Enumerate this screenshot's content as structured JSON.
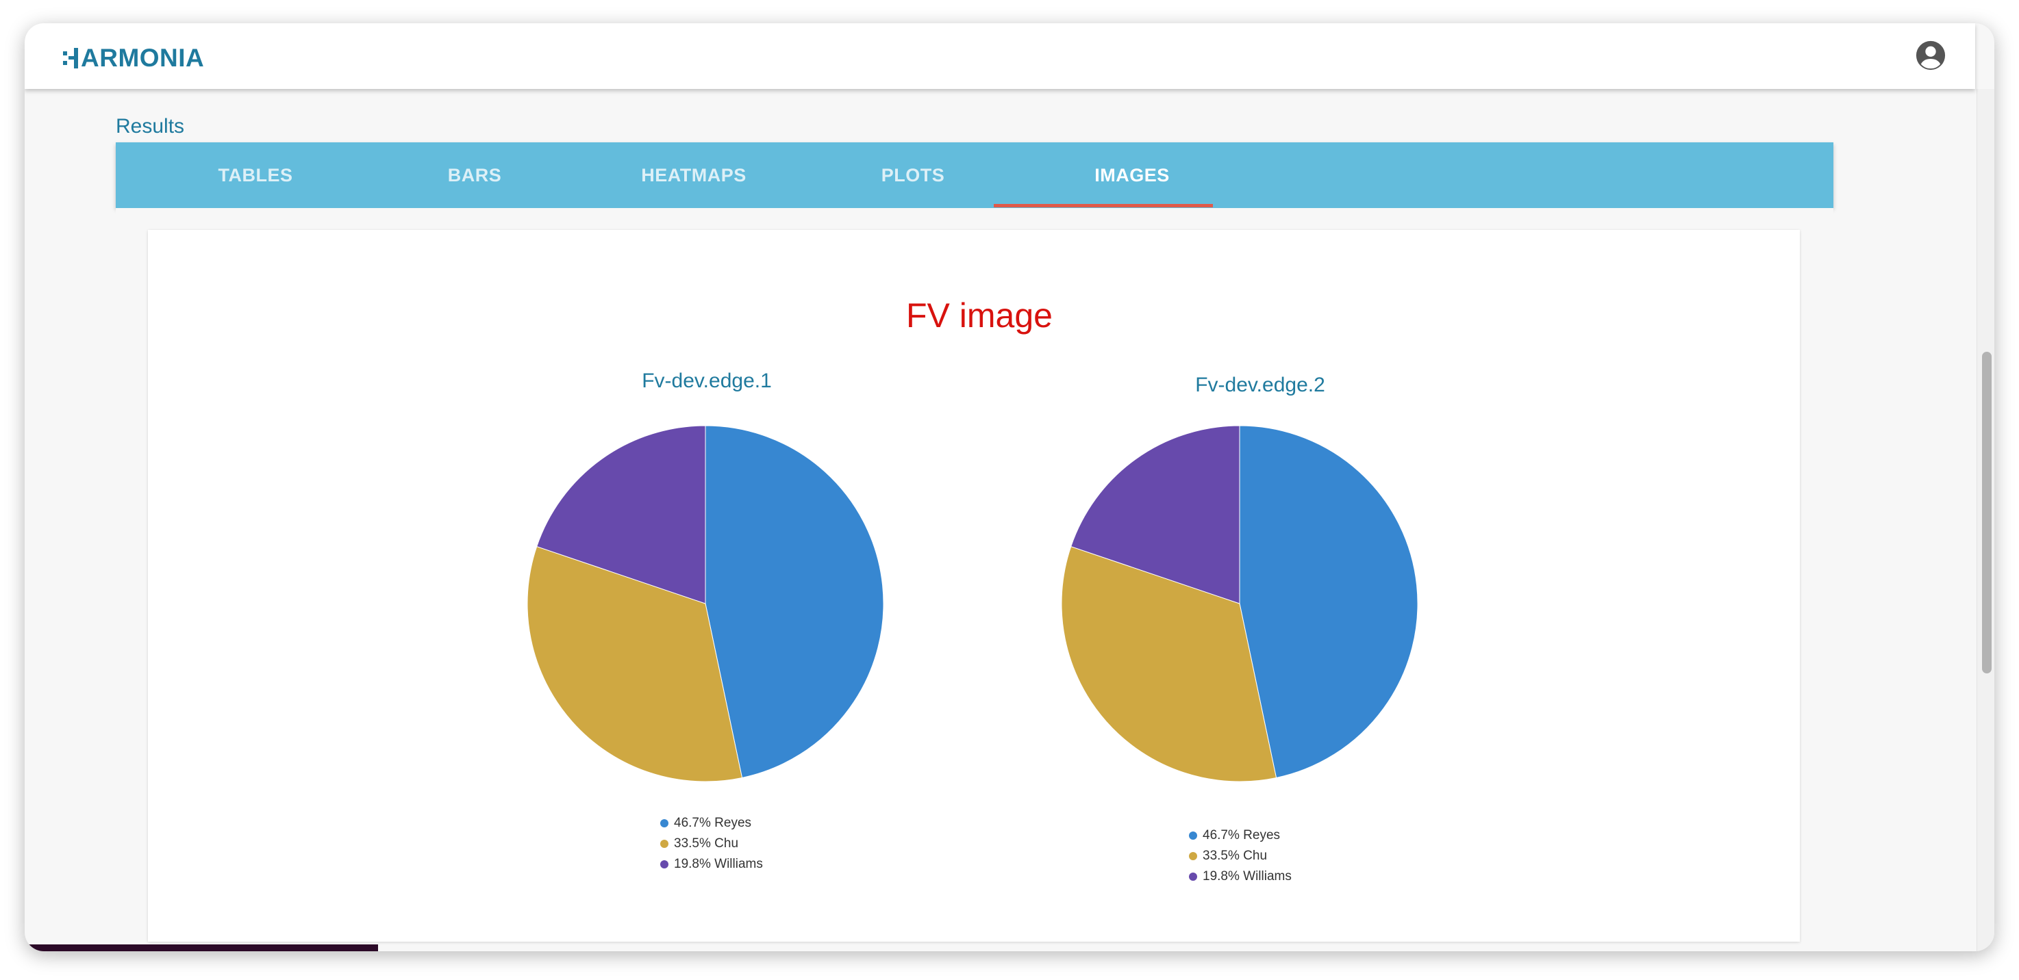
{
  "app": {
    "name": "ARMONIA"
  },
  "header": {
    "account_icon": "account-circle-icon"
  },
  "page": {
    "section_label": "Results"
  },
  "tabs": [
    {
      "label": "TABLES",
      "active": false
    },
    {
      "label": "BARS",
      "active": false
    },
    {
      "label": "HEATMAPS",
      "active": false
    },
    {
      "label": "PLOTS",
      "active": false
    },
    {
      "label": "IMAGES",
      "active": true
    }
  ],
  "card": {
    "title": "FV image"
  },
  "colors": {
    "brand": "#1f7a9e",
    "tab_bar": "#63bcdc",
    "tab_indicator": "#e05a4a",
    "title_red": "#d8120e",
    "reyes": "#3787d1",
    "chu": "#cfa842",
    "williams": "#674aac"
  },
  "chart_data": [
    {
      "type": "pie",
      "title": "Fv-dev.edge.1",
      "slices": [
        {
          "label": "Reyes",
          "value": 46.7,
          "legend": "46.7% Reyes",
          "color": "#3787d1"
        },
        {
          "label": "Chu",
          "value": 33.5,
          "legend": "33.5% Chu",
          "color": "#cfa842"
        },
        {
          "label": "Williams",
          "value": 19.8,
          "legend": "19.8% Williams",
          "color": "#674aac"
        }
      ],
      "legend_position": "bottom"
    },
    {
      "type": "pie",
      "title": "Fv-dev.edge.2",
      "slices": [
        {
          "label": "Reyes",
          "value": 46.7,
          "legend": "46.7% Reyes",
          "color": "#3787d1"
        },
        {
          "label": "Chu",
          "value": 33.5,
          "legend": "33.5% Chu",
          "color": "#cfa842"
        },
        {
          "label": "Williams",
          "value": 19.8,
          "legend": "19.8% Williams",
          "color": "#674aac"
        }
      ],
      "legend_position": "bottom"
    }
  ]
}
